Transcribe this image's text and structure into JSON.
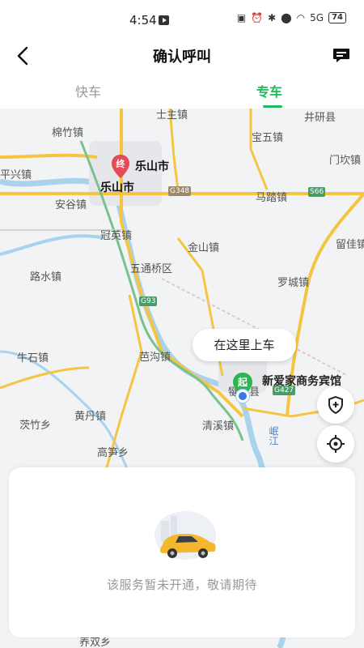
{
  "status_bar": {
    "time": "4:54",
    "battery": "74",
    "signal_text": "5G"
  },
  "header": {
    "title": "确认呼叫"
  },
  "tabs": [
    {
      "label": "快车",
      "active": false
    },
    {
      "label": "专车",
      "active": true
    }
  ],
  "map": {
    "labels": [
      "士主镇",
      "井研县",
      "棉竹镇",
      "宝五镇",
      "门坎镇",
      "平兴镇",
      "安谷镇",
      "马踏镇",
      "留佳镇",
      "冠英镇",
      "金山镇",
      "路水镇",
      "五通桥区",
      "罗城镇",
      "牛石镇",
      "芭沟镇",
      "茨竹乡",
      "黄丹镇",
      "清溪镇",
      "高笋乡",
      "养双乡"
    ],
    "city_labels": [
      "乐山市",
      "乐山市"
    ],
    "road_badges": [
      "G348",
      "S66",
      "G93",
      "G427"
    ],
    "river_label": "岷江",
    "town_label": "犍为县",
    "pickup_hint": "在这里上车",
    "hotel_name": "新爱家商务宾馆",
    "end_pin_text": "终",
    "start_pin_text": "起"
  },
  "panel": {
    "message": "该服务暂未开通，敬请期待"
  },
  "colors": {
    "accent": "#1fb85c",
    "end_pin": "#e24b57",
    "start_pin": "#2db552",
    "location_dot": "#3a78e8"
  }
}
